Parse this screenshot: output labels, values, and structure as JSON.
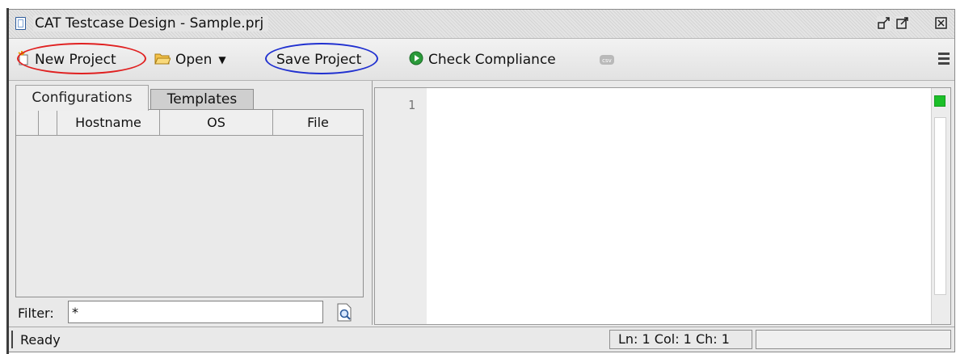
{
  "window": {
    "title": "CAT Testcase Design - Sample.prj",
    "controls": [
      "restore-icon",
      "maximize-icon",
      "close-icon"
    ]
  },
  "toolbar": {
    "new_project": "New Project",
    "open": "Open",
    "save_project": "Save Project",
    "check_compliance": "Check Compliance",
    "extra_icon": "csv-icon",
    "menu_icon": "hamburger-menu-icon"
  },
  "annotations": {
    "new_project_highlight_color": "#e02020",
    "save_project_highlight_color": "#2030d0"
  },
  "left_panel": {
    "tabs": [
      {
        "label": "Configurations",
        "active": true
      },
      {
        "label": "Templates",
        "active": false
      }
    ],
    "table": {
      "columns": [
        "",
        "",
        "Hostname",
        "OS",
        "File"
      ],
      "rows": []
    },
    "filter": {
      "label": "Filter:",
      "value": "*"
    }
  },
  "editor": {
    "line_numbers": [
      "1"
    ],
    "content": ""
  },
  "status": {
    "text": "Ready",
    "position": "Ln: 1 Col: 1 Ch: 1"
  }
}
